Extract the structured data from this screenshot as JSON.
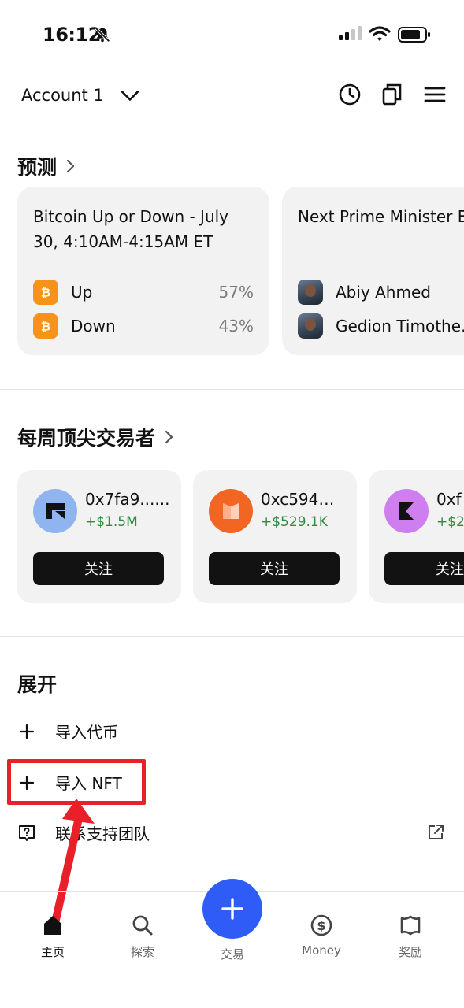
{
  "status": {
    "time": "16:12"
  },
  "header": {
    "account_name": "Account 1"
  },
  "predictions": {
    "title": "预测",
    "cards": [
      {
        "title": "Bitcoin Up or Down - July 30, 4:10AM-4:15AM ET",
        "outcomes": [
          {
            "label": "Up",
            "percent": "57%"
          },
          {
            "label": "Down",
            "percent": "43%"
          }
        ]
      },
      {
        "title": "Next Prime Minister Ethiopia?",
        "outcomes": [
          {
            "label": "Abiy Ahmed"
          },
          {
            "label": "Gedion Timothe…"
          }
        ]
      }
    ]
  },
  "top_traders": {
    "title": "每周顶尖交易者",
    "follow_label": "关注",
    "traders": [
      {
        "address": "0x7fa9......",
        "gain": "+$1.5M",
        "avatar_color": "#8fb4f0"
      },
      {
        "address": "0xc594…",
        "gain": "+$529.1K",
        "avatar_color": "#f26522"
      },
      {
        "address": "0xf",
        "gain": "+$2",
        "avatar_color": "#cf7ef0"
      }
    ]
  },
  "expand": {
    "title": "展开",
    "items": [
      {
        "label": "导入代币"
      },
      {
        "label": "导入 NFT"
      },
      {
        "label": "联系支持团队"
      }
    ]
  },
  "tabbar": {
    "tabs": [
      {
        "label": "主页",
        "icon": "home-icon"
      },
      {
        "label": "探索",
        "icon": "search-icon"
      },
      {
        "label": "交易",
        "icon": "plus-icon"
      },
      {
        "label": "Money",
        "icon": "dollar-coin-icon"
      },
      {
        "label": "奖励",
        "icon": "reward-icon"
      }
    ]
  },
  "colors": {
    "accent": "#2f5cf6",
    "bitcoin": "#f7931a",
    "gain_green": "#2e8b3e",
    "highlight_red": "#e8202a"
  }
}
